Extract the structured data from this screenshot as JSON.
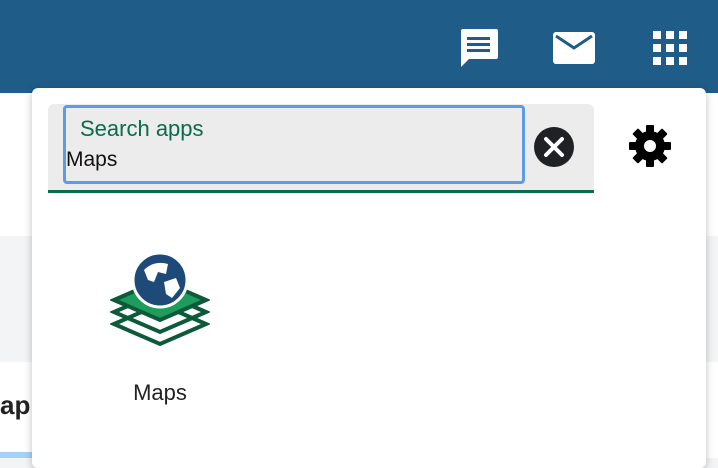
{
  "topbar": {
    "icons": [
      "chat-icon",
      "mail-icon",
      "apps-grid-icon"
    ],
    "color": "#1f5c88"
  },
  "background": {
    "partial_text": "ap"
  },
  "app_search": {
    "label": "Search apps",
    "value": "Maps",
    "accent_color": "#0a6b4f",
    "focus_color": "#5d9ae8"
  },
  "results": [
    {
      "label": "Maps",
      "icon": "maps-icon"
    }
  ]
}
